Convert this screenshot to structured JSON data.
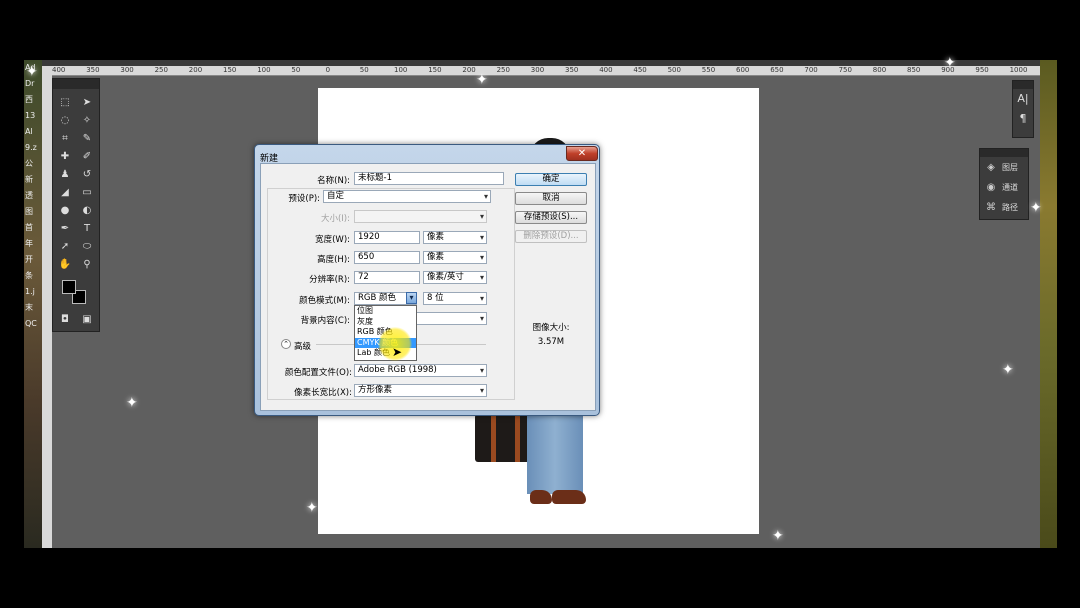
{
  "rulers": {
    "top": [
      "400",
      "350",
      "300",
      "250",
      "200",
      "150",
      "100",
      "50",
      "0",
      "50",
      "100",
      "150",
      "200",
      "250",
      "300",
      "350",
      "400",
      "450",
      "500",
      "550",
      "600",
      "650",
      "700",
      "750",
      "800",
      "850",
      "900",
      "950",
      "1000"
    ]
  },
  "desktop_left": [
    "Ad",
    "Dr",
    "西",
    "13",
    "Al",
    "9.z",
    "公",
    "新",
    "透",
    "",
    "",
    "",
    "",
    "",
    "",
    "",
    "",
    "",
    "",
    "",
    "",
    "",
    "图",
    "首",
    "年",
    "开",
    "条",
    "1.j",
    "末",
    "QC"
  ],
  "panels": {
    "right_icons": [
      "A|",
      "¶"
    ],
    "layers": [
      {
        "icon": "layers-icon",
        "glyph": "◈",
        "label": "图层"
      },
      {
        "icon": "channels-icon",
        "glyph": "◉",
        "label": "通道"
      },
      {
        "icon": "paths-icon",
        "glyph": "⌘",
        "label": "路径"
      }
    ]
  },
  "dialog": {
    "title": "新建",
    "close_glyph": "✕",
    "name_label": "名称(N):",
    "name_value": "未标题-1",
    "preset_label": "预设(P):",
    "preset_value": "自定",
    "size_label": "大小(I):",
    "size_value": "",
    "width_label": "宽度(W):",
    "width_value": "1920",
    "width_unit": "像素",
    "height_label": "高度(H):",
    "height_value": "650",
    "height_unit": "像素",
    "resolution_label": "分辨率(R):",
    "resolution_value": "72",
    "resolution_unit": "像素/英寸",
    "color_mode_label": "颜色模式(M):",
    "color_mode_value": "RGB 颜色",
    "bit_depth_value": "8 位",
    "background_label": "背景内容(C):",
    "advanced_label": "高级",
    "color_profile_label": "颜色配置文件(O):",
    "color_profile_value": "Adobe RGB (1998)",
    "pixel_aspect_label": "像素长宽比(X):",
    "pixel_aspect_value": "方形像素",
    "ok_button": "确定",
    "cancel_button": "取消",
    "save_preset_button": "存储预设(S)...",
    "delete_preset_button": "删除预设(D)...",
    "image_size_label": "图像大小:",
    "image_size_value": "3.57M",
    "color_mode_options": [
      "位图",
      "灰度",
      "RGB 颜色",
      "CMYK 颜色",
      "Lab 颜色"
    ],
    "highlighted_option": "CMYK 颜色"
  }
}
